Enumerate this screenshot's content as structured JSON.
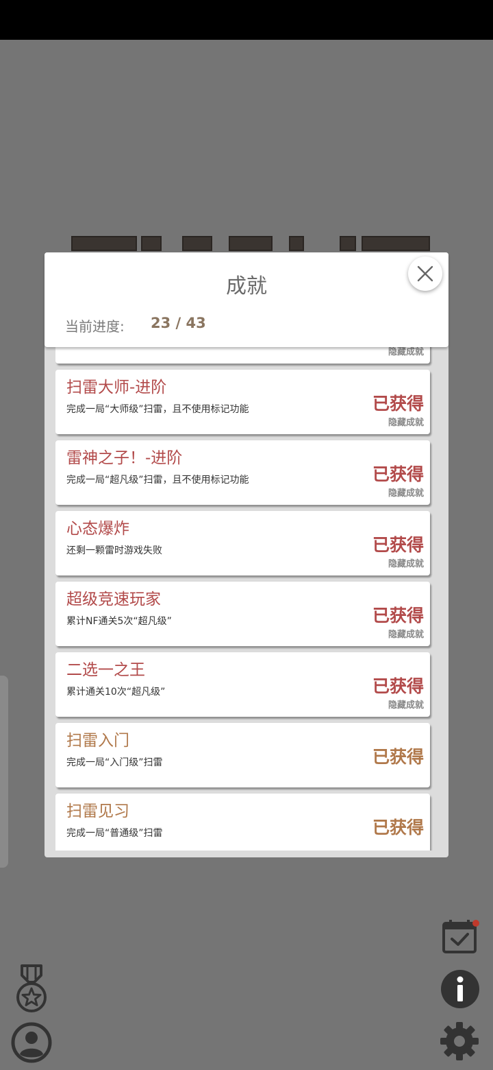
{
  "dialog": {
    "title": "成就",
    "progress_label": "当前进度:",
    "progress_value": "23 / 43"
  },
  "achievements": [
    {
      "name": "",
      "desc": "",
      "status": "",
      "hidden_tag": "隐藏成就",
      "tone": "red",
      "partial": true
    },
    {
      "name": "扫雷大师-进阶",
      "desc": "完成一局“大师级”扫雷，且不使用标记功能",
      "status": "已获得",
      "hidden_tag": "隐藏成就",
      "tone": "red"
    },
    {
      "name": "雷神之子！-进阶",
      "desc": "完成一局“超凡级”扫雷，且不使用标记功能",
      "status": "已获得",
      "hidden_tag": "隐藏成就",
      "tone": "red"
    },
    {
      "name": "心态爆炸",
      "desc": "还剩一颗雷时游戏失败",
      "status": "已获得",
      "hidden_tag": "隐藏成就",
      "tone": "red"
    },
    {
      "name": "超级竞速玩家",
      "desc": "累计NF通关5次“超凡级”",
      "status": "已获得",
      "hidden_tag": "隐藏成就",
      "tone": "red"
    },
    {
      "name": "二选一之王",
      "desc": "累计通关10次“超凡级”",
      "status": "已获得",
      "hidden_tag": "隐藏成就",
      "tone": "red"
    },
    {
      "name": "扫雷入门",
      "desc": "完成一局“入门级”扫雷",
      "status": "已获得",
      "hidden_tag": "",
      "tone": "brown"
    },
    {
      "name": "扫雷见习",
      "desc": "完成一局“普通级”扫雷",
      "status": "已获得",
      "hidden_tag": "",
      "tone": "brown"
    }
  ],
  "icons": {
    "close": "close-icon",
    "medal": "medal-star-icon",
    "profile": "profile-icon",
    "calendar": "calendar-check-icon",
    "info": "info-icon",
    "settings": "gear-icon"
  },
  "colors": {
    "background": "#757575",
    "hidden_achievement": "#b24a4a",
    "normal_achievement": "#b0784a",
    "notification_dot": "#c0392b"
  }
}
